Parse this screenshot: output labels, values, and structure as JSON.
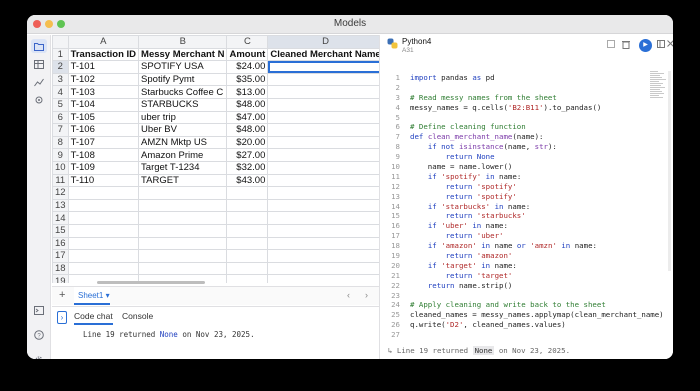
{
  "window": {
    "title": "Models"
  },
  "spreadsheet": {
    "columns": [
      "A",
      "B",
      "C",
      "D"
    ],
    "rows": [
      [
        "Transaction ID",
        "Messy Merchant N",
        "Amount",
        "Cleaned Merchant Name"
      ],
      [
        "T-101",
        "SPOTIFY USA",
        "$24.00",
        ""
      ],
      [
        "T-102",
        "Spotify Pymt",
        "$35.00",
        ""
      ],
      [
        "T-103",
        "Starbucks Coffee C",
        "$13.00",
        ""
      ],
      [
        "T-104",
        "STARBUCKS",
        "$48.00",
        ""
      ],
      [
        "T-105",
        "uber trip",
        "$47.00",
        ""
      ],
      [
        "T-106",
        "Uber BV",
        "$48.00",
        ""
      ],
      [
        "T-107",
        "AMZN Mktp US",
        "$20.00",
        ""
      ],
      [
        "T-108",
        "Amazon Prime",
        "$27.00",
        ""
      ],
      [
        "T-109",
        "Target T-1234",
        "$32.00",
        ""
      ],
      [
        "T-110",
        "TARGET",
        "$43.00",
        ""
      ],
      [
        "",
        "",
        "",
        ""
      ],
      [
        "",
        "",
        "",
        ""
      ],
      [
        "",
        "",
        "",
        ""
      ],
      [
        "",
        "",
        "",
        ""
      ],
      [
        "",
        "",
        "",
        ""
      ],
      [
        "",
        "",
        "",
        ""
      ],
      [
        "",
        "",
        "",
        ""
      ],
      [
        "",
        "",
        "",
        ""
      ],
      [
        "",
        "",
        "",
        ""
      ]
    ],
    "row_numbers": [
      "1",
      "2",
      "3",
      "4",
      "5",
      "6",
      "7",
      "8",
      "9",
      "10",
      "11",
      "12",
      "13",
      "14",
      "15",
      "16",
      "17",
      "18",
      "19",
      "20"
    ],
    "selected_cell": "D2"
  },
  "sheet_tabs": {
    "add_label": "+",
    "active_tab": "Sheet1",
    "tab_caret": "▾",
    "prev_arrow": "‹",
    "next_arrow": "›"
  },
  "bottom_panel": {
    "toggle_icon": "›",
    "tabs": [
      "Code chat",
      "Console"
    ],
    "log_prefix": "Line 19 returned ",
    "log_value": "None",
    "log_suffix": " on Nov 23, 2025."
  },
  "editor": {
    "title": "Python4",
    "cell_ref": "A31",
    "run_icon": "▶",
    "code_lines": [
      {
        "n": "1",
        "html": "<span class=\"kw\">import</span> pandas <span class=\"kw\">as</span> pd"
      },
      {
        "n": "2",
        "html": ""
      },
      {
        "n": "3",
        "html": "<span class=\"cm\"># Read messy names from the sheet</span>"
      },
      {
        "n": "4",
        "html": "messy_names = q.cells(<span class=\"str\">'B2:B11'</span>).to_pandas()"
      },
      {
        "n": "5",
        "html": ""
      },
      {
        "n": "6",
        "html": "<span class=\"cm\"># Define cleaning function</span>"
      },
      {
        "n": "7",
        "html": "<span class=\"kw\">def</span> <span class=\"fn\">clean_merchant_name</span>(name):"
      },
      {
        "n": "8",
        "html": "    <span class=\"kw\">if not</span> <span class=\"fn\">isinstance</span>(name, <span class=\"fn\">str</span>):"
      },
      {
        "n": "9",
        "html": "        <span class=\"kw\">return</span> <span class=\"kw\">None</span>"
      },
      {
        "n": "10",
        "html": "    name = name.lower()"
      },
      {
        "n": "11",
        "html": "    <span class=\"kw\">if</span> <span class=\"str\">'spotify'</span> <span class=\"kw\">in</span> name:"
      },
      {
        "n": "12",
        "html": "        <span class=\"kw\">return</span> <span class=\"str\">'spotify'</span>"
      },
      {
        "n": "13",
        "html": "        <span class=\"kw\">return</span> <span class=\"str\">'spotify'</span>"
      },
      {
        "n": "14",
        "html": "    <span class=\"kw\">if</span> <span class=\"str\">'starbucks'</span> <span class=\"kw\">in</span> name:"
      },
      {
        "n": "15",
        "html": "        <span class=\"kw\">return</span> <span class=\"str\">'starbucks'</span>"
      },
      {
        "n": "16",
        "html": "    <span class=\"kw\">if</span> <span class=\"str\">'uber'</span> <span class=\"kw\">in</span> name:"
      },
      {
        "n": "17",
        "html": "        <span class=\"kw\">return</span> <span class=\"str\">'uber'</span>"
      },
      {
        "n": "18",
        "html": "    <span class=\"kw\">if</span> <span class=\"str\">'amazon'</span> <span class=\"kw\">in</span> name <span class=\"kw\">or</span> <span class=\"str\">'amzn'</span> <span class=\"kw\">in</span> name:"
      },
      {
        "n": "19",
        "html": "        <span class=\"kw\">return</span> <span class=\"str\">'amazon'</span>"
      },
      {
        "n": "20",
        "html": "    <span class=\"kw\">if</span> <span class=\"str\">'target'</span> <span class=\"kw\">in</span> name:"
      },
      {
        "n": "21",
        "html": "        <span class=\"kw\">return</span> <span class=\"str\">'target'</span>"
      },
      {
        "n": "22",
        "html": "    <span class=\"kw\">return</span> name.strip()"
      },
      {
        "n": "23",
        "html": ""
      },
      {
        "n": "24",
        "html": "<span class=\"cm\"># Apply cleaning and write back to the sheet</span>"
      },
      {
        "n": "25",
        "html": "cleaned_names = messy_names.applymap(clean_merchant_name)"
      },
      {
        "n": "26",
        "html": "q.write(<span class=\"str\">'D2'</span>, cleaned_names.values)"
      },
      {
        "n": "27",
        "html": ""
      }
    ],
    "log_arrow": "↳",
    "log_prefix": "Line 19 returned ",
    "log_value": "None",
    "log_suffix": " on Nov 23, 2025."
  },
  "colors": {
    "accent": "#2a6fd6",
    "keyword": "#1f3fbf",
    "string": "#b02a2a",
    "comment": "#2f7d32"
  }
}
